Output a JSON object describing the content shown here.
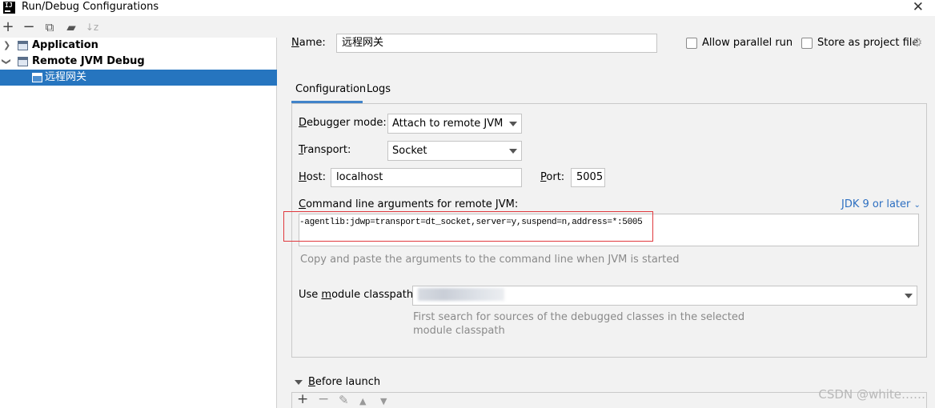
{
  "window": {
    "title": "Run/Debug Configurations",
    "logo_text": "IJ"
  },
  "left_toolbar": {
    "icons": [
      "add-icon",
      "remove-icon",
      "copy-icon",
      "folder-icon",
      "sort-icon"
    ]
  },
  "tree": {
    "items": [
      {
        "label": "Application",
        "expanded": false
      },
      {
        "label": "Remote JVM Debug",
        "expanded": true
      },
      {
        "label": "远程网关",
        "selected": true
      }
    ]
  },
  "form": {
    "name_label": "Name:",
    "name_value": "远程网关",
    "allow_parallel_label": "Allow parallel run",
    "store_project_label": "Store as project file"
  },
  "tabs": [
    "Configuration",
    "Logs"
  ],
  "config": {
    "debugger_mode_label": "Debugger mode:",
    "debugger_mode_value": "Attach to remote JVM",
    "transport_label": "Transport:",
    "transport_value": "Socket",
    "host_label": "Host:",
    "host_value": "localhost",
    "port_label": "Port:",
    "port_value": "5005",
    "cmd_label": "Command line arguments for remote JVM:",
    "jdk_link": "JDK 9 or later",
    "cmd_value": "-agentlib:jdwp=transport=dt_socket,server=y,suspend=n,address=*:5005",
    "cmd_hint": "Copy and paste the arguments to the command line when JVM is started",
    "module_label": "Use module classpath:",
    "module_hint_line1": "First search for sources of the debugged classes in the selected",
    "module_hint_line2": "module classpath"
  },
  "before_launch": {
    "label": "Before launch"
  },
  "watermark": "CSDN @white……",
  "colors": {
    "selection": "#2675bf",
    "link": "#2d6fc1",
    "highlight_box": "#e0393e"
  }
}
